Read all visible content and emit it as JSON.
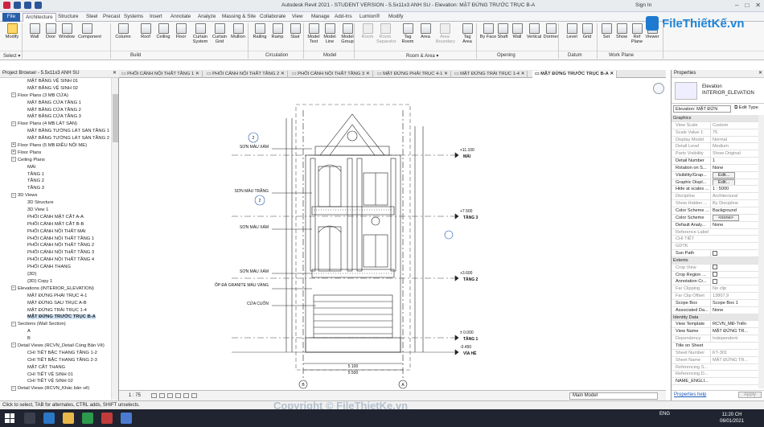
{
  "app": {
    "title": "Autodesk Revit 2021 - STUDENT VERSION - 5.5x11x3 ANH SU - Elevation: MẶT ĐỨNG TRƯỚC TRỤC B-A",
    "sign_in": "Sign In",
    "logo_text": "FileThiếtKế.vn"
  },
  "ribbon": {
    "tabs": [
      "File",
      "Architecture",
      "Structure",
      "Steel",
      "Precast",
      "Systems",
      "Insert",
      "Annotate",
      "Analyze",
      "Massing & Site",
      "Collaborate",
      "View",
      "Manage",
      "Add-Ins",
      "Lumion®",
      "Modify"
    ],
    "active_tab": "Architecture",
    "tools": [
      {
        "label": "Modify",
        "enabled": true
      },
      {
        "label": "Wall",
        "enabled": true
      },
      {
        "label": "Door",
        "enabled": true
      },
      {
        "label": "Window",
        "enabled": true
      },
      {
        "label": "Component",
        "enabled": true
      },
      {
        "label": "Column",
        "enabled": true
      },
      {
        "label": "Roof",
        "enabled": true
      },
      {
        "label": "Ceiling",
        "enabled": true
      },
      {
        "label": "Floor",
        "enabled": true
      },
      {
        "label": "Curtain System",
        "enabled": true
      },
      {
        "label": "Curtain Grid",
        "enabled": true
      },
      {
        "label": "Mullion",
        "enabled": true
      },
      {
        "label": "Railing",
        "enabled": true
      },
      {
        "label": "Ramp",
        "enabled": true
      },
      {
        "label": "Stair",
        "enabled": true
      },
      {
        "label": "Model Text",
        "enabled": true
      },
      {
        "label": "Model Line",
        "enabled": true
      },
      {
        "label": "Model Group",
        "enabled": true
      },
      {
        "label": "Room",
        "enabled": false
      },
      {
        "label": "Room Separator",
        "enabled": false
      },
      {
        "label": "Tag Room",
        "enabled": true
      },
      {
        "label": "Area",
        "enabled": true
      },
      {
        "label": "Area Boundary",
        "enabled": false
      },
      {
        "label": "Tag Area",
        "enabled": true
      },
      {
        "label": "By Face",
        "enabled": true
      },
      {
        "label": "Shaft",
        "enabled": true
      },
      {
        "label": "Wall",
        "enabled": true
      },
      {
        "label": "Vertical",
        "enabled": true
      },
      {
        "label": "Dormer",
        "enabled": true
      },
      {
        "label": "Level",
        "enabled": true
      },
      {
        "label": "Grid",
        "enabled": true
      },
      {
        "label": "Set",
        "enabled": true
      },
      {
        "label": "Show",
        "enabled": true
      },
      {
        "label": "Ref Plane",
        "enabled": true
      },
      {
        "label": "Viewer",
        "enabled": true
      }
    ],
    "panels": [
      "Select ▾",
      "Build",
      "Circulation",
      "Model",
      "Room & Area ▾",
      "Opening",
      "Datum",
      "Work Plane"
    ]
  },
  "project_browser": {
    "title": "Project Browser - 5.5x11x3 ANH SU",
    "items": [
      {
        "label": "MẶT BẰNG VỆ SINH 01",
        "level": 2
      },
      {
        "label": "MẶT BẰNG VỆ SINH 02",
        "level": 2
      },
      {
        "label": "Floor Plans (3 MB CỬA)",
        "level": 1,
        "toggle": "−"
      },
      {
        "label": "MẶT BẰNG CỬA TẦNG 1",
        "level": 2
      },
      {
        "label": "MẶT BẰNG CỬA TẦNG 2",
        "level": 2
      },
      {
        "label": "MẶT BẰNG CỬA TẦNG 3",
        "level": 2
      },
      {
        "label": "Floor Plans (4 MB LÁT SÀN)",
        "level": 1,
        "toggle": "−"
      },
      {
        "label": "MẶT BẰNG TƯỜNG LÁT SÀN TẦNG 1",
        "level": 2
      },
      {
        "label": "MẶT BẰNG TƯỜNG LÁT SÀN TẦNG 2",
        "level": 2
      },
      {
        "label": "Floor Plans (5 MB ĐIỀU NỘI ME)",
        "level": 1,
        "toggle": "+"
      },
      {
        "label": "Floor Plans",
        "level": 1,
        "toggle": "+"
      },
      {
        "label": "Ceiling Plans",
        "level": 1,
        "toggle": "−"
      },
      {
        "label": "MÁI",
        "level": 2
      },
      {
        "label": "TẦNG 1",
        "level": 2
      },
      {
        "label": "TẦNG 2",
        "level": 2
      },
      {
        "label": "TẦNG 3",
        "level": 2
      },
      {
        "label": "3D Views",
        "level": 1,
        "toggle": "−"
      },
      {
        "label": "3D Structure",
        "level": 2
      },
      {
        "label": "3D View 1",
        "level": 2
      },
      {
        "label": "PHỐI CẢNH MẶT CẮT A-A",
        "level": 2
      },
      {
        "label": "PHỐI CẢNH MẶT CẮT B-B",
        "level": 2
      },
      {
        "label": "PHỐI CẢNH NỘI THẤT MÁI",
        "level": 2
      },
      {
        "label": "PHỐI CẢNH NỘI THẤT TẦNG 1",
        "level": 2
      },
      {
        "label": "PHỐI CẢNH NỘI THẤT TẦNG 2",
        "level": 2
      },
      {
        "label": "PHỐI CẢNH NỘI THẤT TẦNG 3",
        "level": 2
      },
      {
        "label": "PHỐI CẢNH NỘI THẤT TẦNG 4",
        "level": 2
      },
      {
        "label": "PHỐI CẢNH THANG",
        "level": 2
      },
      {
        "label": "{3D}",
        "level": 2
      },
      {
        "label": "{3D} Copy 1",
        "level": 2
      },
      {
        "label": "Elevations (INTERIOR_ELEVATION)",
        "level": 1,
        "toggle": "−"
      },
      {
        "label": "MẶT ĐỨNG PHẢI TRỤC 4-1",
        "level": 2
      },
      {
        "label": "MẶT ĐỨNG SAU TRỤC A-B",
        "level": 2
      },
      {
        "label": "MẶT ĐỨNG TRÁI TRỤC 1-4",
        "level": 2
      },
      {
        "label": "MẶT ĐỨNG TRƯỚC TRỤC B-A",
        "level": 2,
        "selected": true
      },
      {
        "label": "Sections (Wall Section)",
        "level": 1,
        "toggle": "−"
      },
      {
        "label": "A",
        "level": 2
      },
      {
        "label": "B",
        "level": 2
      },
      {
        "label": "Detail Views (RCVN_Detail Cùng Bản Vẽ)",
        "level": 1,
        "toggle": "−"
      },
      {
        "label": "CHI TIẾT BẬC THANG TẦNG 1-2",
        "level": 2
      },
      {
        "label": "CHI TIẾT BẬC THANG TẦNG 2-3",
        "level": 2
      },
      {
        "label": "MẶT CẮT THANG",
        "level": 2
      },
      {
        "label": "CHI TIẾT VỆ SINH 01",
        "level": 2
      },
      {
        "label": "CHI TIẾT VỆ SINH 02",
        "level": 2
      },
      {
        "label": "Detail Views (RCVN_Khác bản vẽ)",
        "level": 1,
        "toggle": "−"
      }
    ]
  },
  "view_tabs": [
    {
      "label": "PHỐI CẢNH NỘI THẤT TẦNG 1",
      "active": false
    },
    {
      "label": "PHỐI CẢNH NỘI THẤT TẦNG 2",
      "active": false
    },
    {
      "label": "PHỐI CẢNH NỘI THẤT TẦNG 3",
      "active": false
    },
    {
      "label": "MẶT ĐỨNG PHẢI TRỤC 4-1",
      "active": false
    },
    {
      "label": "MẶT ĐỨNG TRÁI TRỤC 1-4",
      "active": false
    },
    {
      "label": "MẶT ĐỨNG TRƯỚC TRỤC B-A",
      "active": true
    }
  ],
  "drawing": {
    "left_notes": [
      "SƠN MÀU XÁM",
      "SƠN MÀU TRẮNG",
      "SƠN MÀU XÁM",
      "SƠN MÀU XÁM",
      "ỐP ĐÁ GRANITE MÀU VÀNG",
      "CỬA CUỐN"
    ],
    "levels": [
      {
        "elev": "+11.100",
        "name": "MÁI"
      },
      {
        "elev": "+7.500",
        "name": "TẦNG 3"
      },
      {
        "elev": "+3.600",
        "name": "TẦNG 2"
      },
      {
        "elev": "± 0.000",
        "name": "TẦNG 1"
      },
      {
        "elev": "-0.450",
        "name": "VỈA HÈ"
      }
    ],
    "dims_bottom": [
      "5 100",
      "5 500"
    ],
    "grids": [
      "B",
      "A"
    ],
    "section_tags": [
      "2",
      "2"
    ]
  },
  "view_control": {
    "scale": "1 : 75",
    "main_model": "Main Model"
  },
  "properties": {
    "title": "Properties",
    "type_line1": "Elevation",
    "type_line2": "INTERIOR_ELEVATION",
    "selector": "Elevation: MẶT ĐỨN",
    "edit_type": "Edit Type",
    "rows": [
      {
        "k": "Graphics",
        "section": true
      },
      {
        "k": "View Scale",
        "v": "Custom",
        "grey": true
      },
      {
        "k": "Scale Value 1:",
        "v": "75",
        "grey": true
      },
      {
        "k": "Display Model",
        "v": "Normal",
        "grey": true
      },
      {
        "k": "Detail Level",
        "v": "Medium",
        "grey": true
      },
      {
        "k": "Parts Visibility",
        "v": "Show Original",
        "grey": true
      },
      {
        "k": "Detail Number",
        "v": "1"
      },
      {
        "k": "Rotation on S...",
        "v": "None"
      },
      {
        "k": "Visibility/Grap...",
        "v": "Edit...",
        "btn": true
      },
      {
        "k": "Graphic Displ...",
        "v": "Edit...",
        "btn": true
      },
      {
        "k": "Hide at scales ...",
        "v": "1 : 5000"
      },
      {
        "k": "Discipline",
        "v": "Architectural",
        "grey": true
      },
      {
        "k": "Show Hidden ...",
        "v": "By Discipline",
        "grey": true
      },
      {
        "k": "Color Scheme ...",
        "v": "Background"
      },
      {
        "k": "Color Scheme",
        "v": "<none>",
        "btn": true
      },
      {
        "k": "Default Analy...",
        "v": "None"
      },
      {
        "k": "Reference Label",
        "v": "",
        "grey": true
      },
      {
        "k": "CHI TIẾT",
        "v": "",
        "grey": true
      },
      {
        "k": "GDTK",
        "v": "",
        "grey": true
      },
      {
        "k": "Sun Path",
        "v": "",
        "chk": true
      },
      {
        "k": "Extents",
        "section": true
      },
      {
        "k": "Crop View",
        "v": "",
        "chk": true,
        "grey": true
      },
      {
        "k": "Crop Region ...",
        "v": "",
        "chk": true
      },
      {
        "k": "Annotation Cr...",
        "v": "",
        "chk": true
      },
      {
        "k": "Far Clipping",
        "v": "No clip",
        "grey": true
      },
      {
        "k": "Far Clip Offset",
        "v": "13807,9",
        "grey": true
      },
      {
        "k": "Scope Box",
        "v": "Scope Box 1"
      },
      {
        "k": "Associated Da...",
        "v": "None"
      },
      {
        "k": "Identity Data",
        "section": true
      },
      {
        "k": "View Template",
        "v": "RCVN_MĐ-Triển"
      },
      {
        "k": "View Name",
        "v": "MẶT ĐỨNG TR..."
      },
      {
        "k": "Dependency",
        "v": "Independent",
        "grey": true
      },
      {
        "k": "Title on Sheet",
        "v": ""
      },
      {
        "k": "Sheet Number",
        "v": "KT-301",
        "grey": true
      },
      {
        "k": "Sheet Name",
        "v": "MẶT ĐỨNG TR...",
        "grey": true
      },
      {
        "k": "Referencing S...",
        "v": "",
        "grey": true
      },
      {
        "k": "Referencing D...",
        "v": "",
        "grey": true
      },
      {
        "k": "NAME_ENGLI...",
        "v": ""
      }
    ],
    "help": "Properties help",
    "apply": "Apply"
  },
  "status": {
    "message": "Click to select, TAB for alternates, CTRL adds, SHIFT unselects.",
    "watermark": "Copyright © FileThietKe.vn"
  },
  "taskbar": {
    "tray": "ENG",
    "time": "11:20 CH",
    "date": "06/01/2021"
  }
}
